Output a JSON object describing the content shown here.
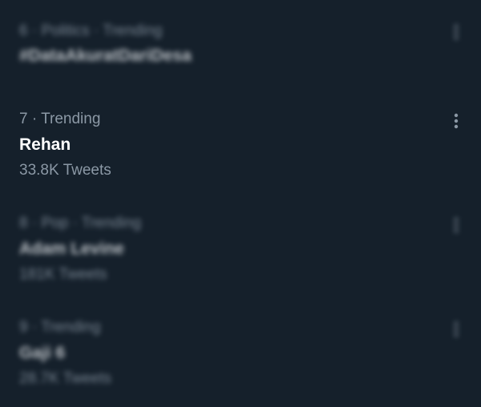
{
  "trends": [
    {
      "meta": "6 · Politics · Trending",
      "name": "#DataAkuratDariDesa",
      "count": ""
    },
    {
      "meta": "7 · Trending",
      "name": "Rehan",
      "count": "33.8K Tweets"
    },
    {
      "meta": "8 · Pop · Trending",
      "name": "Adam Levine",
      "count": "181K Tweets"
    },
    {
      "meta": "9 · Trending",
      "name": "Gaji 6",
      "count": "28.7K Tweets"
    }
  ],
  "icons": {
    "more": "more-vertical-icon"
  },
  "colors": {
    "background": "#15202b",
    "secondary_text": "#8b98a5",
    "primary_text": "#ffffff"
  }
}
